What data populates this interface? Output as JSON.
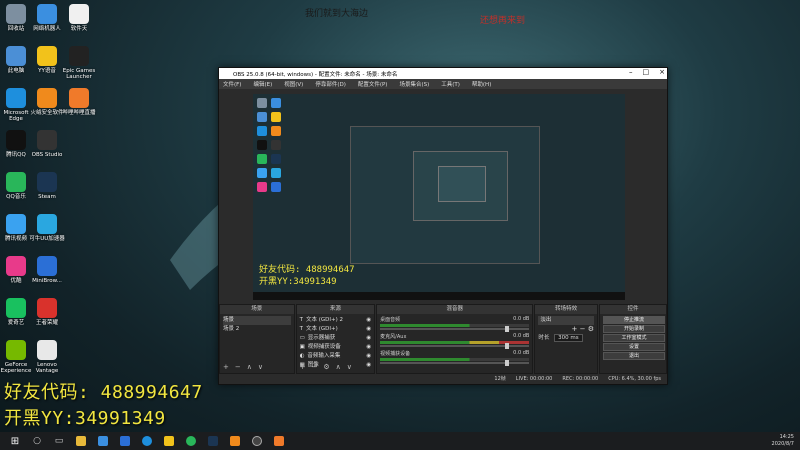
{
  "wallpaper": {
    "text_left": "我们就到大海边",
    "text_right": "还想再来到"
  },
  "desktop_icons": [
    {
      "label": "回收站",
      "color": "#7d8fa0"
    },
    {
      "label": "网络机器人",
      "color": "#3b8fe0"
    },
    {
      "label": "软件天",
      "color": "#f0f0f0"
    },
    {
      "label": "此电脑",
      "color": "#4b8fd6"
    },
    {
      "label": "YY语音",
      "color": "#f2c21b"
    },
    {
      "label": "Epic Games Launcher",
      "color": "#222222"
    },
    {
      "label": "Microsoft Edge",
      "color": "#1e8fdd"
    },
    {
      "label": "火绒安全软件",
      "color": "#f08a1c"
    },
    {
      "label": "哔哩哔哩直播",
      "color": "#f07a2a"
    },
    {
      "label": "腾讯QQ",
      "color": "#111111"
    },
    {
      "label": "OBS Studio",
      "color": "#333333"
    },
    {
      "label": "QQ音乐",
      "color": "#29b65a"
    },
    {
      "label": "Steam",
      "color": "#1b3552"
    },
    {
      "label": "腾讯视频",
      "color": "#3aa2f0"
    },
    {
      "label": "可牛UU加速器",
      "color": "#2aa7e0"
    },
    {
      "label": "优酷",
      "color": "#e83a8a"
    },
    {
      "label": "MiniBrow...",
      "color": "#2b6fd6"
    },
    {
      "label": "爱奇艺",
      "color": "#19c15f"
    },
    {
      "label": "王者荣耀",
      "color": "#d9322c"
    },
    {
      "label": "GeForce Experience",
      "color": "#76b900"
    },
    {
      "label": "Lenovo Vantage",
      "color": "#e8e8e8"
    }
  ],
  "watermark": {
    "line1": "好友代码: 488994647",
    "line2": "开黑YY:34991349"
  },
  "obs": {
    "title": "OBS 25.0.8 (64-bit, windows) - 配置文件: 未命名 - 场景: 未命名",
    "menu": [
      "文件(F)",
      "编辑(E)",
      "视图(V)",
      "停靠部件(D)",
      "配置文件(P)",
      "场景集合(S)",
      "工具(T)",
      "帮助(H)"
    ],
    "docks": {
      "scenes": {
        "title": "场景",
        "items": [
          "场景",
          "场景 2"
        ]
      },
      "sources": {
        "title": "来源",
        "items": [
          "文本 (GDI+) 2",
          "文本 (GDI+)",
          "显示器捕获",
          "视频捕获设备",
          "音频输入采集",
          "图像"
        ]
      },
      "mixer": {
        "title": "混音器",
        "channels": [
          {
            "name": "桌面音频",
            "db": "0.0 dB"
          },
          {
            "name": "麦克风/Aux",
            "db": "0.0 dB"
          },
          {
            "name": "视频捕获设备",
            "db": "0.0 dB"
          }
        ]
      },
      "transitions": {
        "title": "转场特效",
        "mode": "淡出",
        "duration_label": "时长",
        "duration_value": "300 ms"
      },
      "controls": {
        "title": "控件",
        "buttons": [
          "停止推流",
          "开始录制",
          "工作室模式",
          "设置",
          "退出"
        ]
      }
    },
    "status": {
      "drop": "12帧",
      "live": "LIVE: 00:00:00",
      "rec": "REC: 00:00:00",
      "cpu": "CPU: 6.4%, 30.00 fps"
    }
  },
  "taskbar": {
    "time": "14:25",
    "date": "2020/8/7"
  }
}
